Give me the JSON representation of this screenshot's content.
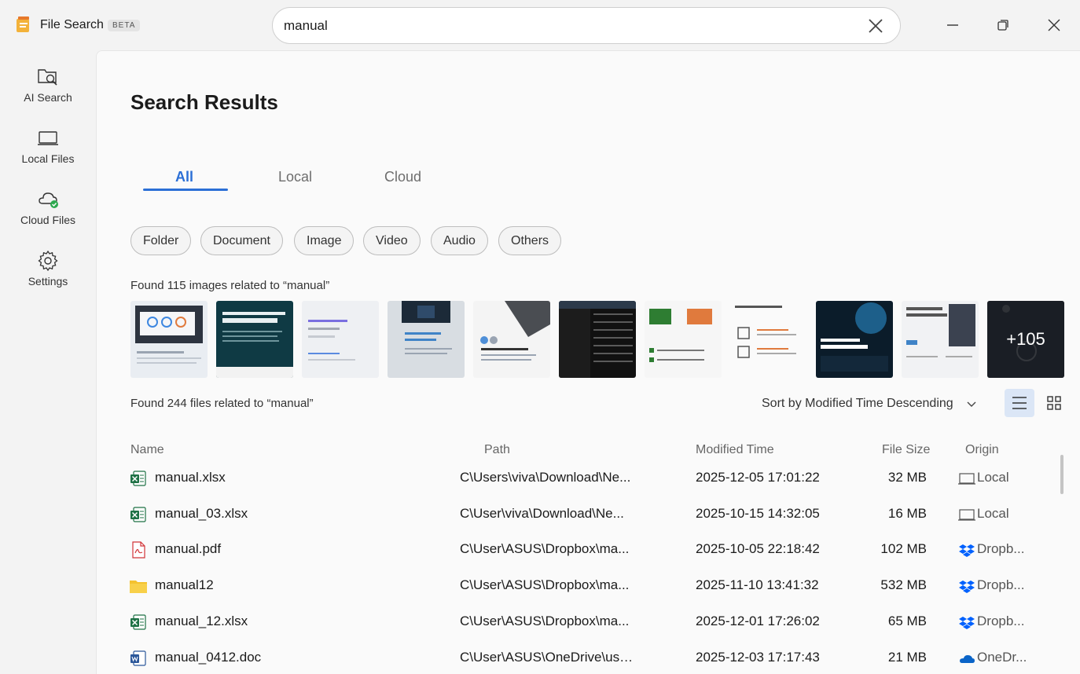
{
  "app": {
    "title": "File Search",
    "badge": "BETA"
  },
  "search": {
    "value": "manual",
    "placeholder": ""
  },
  "sidebar": {
    "items": [
      {
        "label": "AI Search"
      },
      {
        "label": "Local Files"
      },
      {
        "label": "Cloud Files"
      },
      {
        "label": "Settings"
      }
    ]
  },
  "main": {
    "title": "Search Results",
    "tabs": [
      {
        "label": "All"
      },
      {
        "label": "Local"
      },
      {
        "label": "Cloud"
      }
    ],
    "filters": [
      "Folder",
      "Document",
      "Image",
      "Video",
      "Audio",
      "Others"
    ],
    "images_found": "Found 115 images related to “manual”",
    "more_images": "+105",
    "files_found": "Found 244 files related to “manual”",
    "sort_label": "Sort by Modified Time Descending",
    "columns": {
      "name": "Name",
      "path": "Path",
      "time": "Modified Time",
      "size": "File Size",
      "origin": "Origin"
    },
    "files": [
      {
        "name": "manual.xlsx",
        "path": "C\\Users\\viva\\Download\\Ne...",
        "time": "2025-12-05 17:01:22",
        "size": "32 MB",
        "origin": "Local",
        "type": "excel-icon",
        "origin_icon": "laptop-icon"
      },
      {
        "name": "manual_03.xlsx",
        "path": "C\\User\\viva\\Download\\Ne...",
        "time": "2025-10-15 14:32:05",
        "size": "16 MB",
        "origin": "Local",
        "type": "excel-icon",
        "origin_icon": "laptop-icon"
      },
      {
        "name": "manual.pdf",
        "path": "C\\User\\ASUS\\Dropbox\\ma...",
        "time": "2025-10-05 22:18:42",
        "size": "102 MB",
        "origin": "Dropb...",
        "type": "pdf-icon",
        "origin_icon": "dropbox-icon"
      },
      {
        "name": "manual12",
        "path": "C\\User\\ASUS\\Dropbox\\ma...",
        "time": "2025-11-10 13:41:32",
        "size": "532 MB",
        "origin": "Dropb...",
        "type": "folder-icon",
        "origin_icon": "dropbox-icon"
      },
      {
        "name": "manual_12.xlsx",
        "path": "C\\User\\ASUS\\Dropbox\\ma...",
        "time": "2025-12-01 17:26:02",
        "size": "65 MB",
        "origin": "Dropb...",
        "type": "excel-icon",
        "origin_icon": "dropbox-icon"
      },
      {
        "name": "manual_0412.doc",
        "path": "C\\User\\ASUS\\OneDrive\\use...",
        "time": "2025-12-03 17:17:43",
        "size": "21 MB",
        "origin": "OneDr...",
        "type": "word-icon",
        "origin_icon": "onedrive-icon"
      }
    ]
  },
  "colors": {
    "accent": "#2b6fd6",
    "excel": "#1e7145",
    "pdf": "#d13438",
    "folder": "#f4c230",
    "dropbox": "#0061fe",
    "onedrive": "#0a64c8"
  }
}
